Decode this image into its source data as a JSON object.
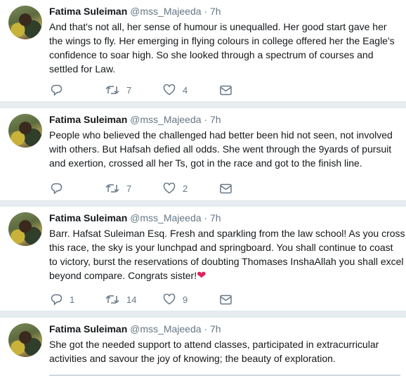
{
  "tweets": [
    {
      "name": "Fatima Suleiman",
      "handle": "@mss_Majeeda",
      "dot": "·",
      "time": "7h",
      "lines": [
        "And that's not all, her sense of humour is unequalled. Her good start gave her",
        "the wings to fly. Her emerging in flying colours in college offered her the Eagle's",
        "confidence to soar high. So she looked through a spectrum of courses and",
        "settled for Law."
      ],
      "reply_count": "",
      "retweet_count": "7",
      "like_count": "4"
    },
    {
      "name": "Fatima Suleiman",
      "handle": "@mss_Majeeda",
      "dot": "·",
      "time": "7h",
      "lines": [
        "People who believed the challenged had better been hid not seen, not involved",
        "with others. But Hafsah defied all odds. She went through the 9yards of pursuit",
        "and exertion, crossed all her Ts, got in the race and got to the finish line."
      ],
      "reply_count": "",
      "retweet_count": "7",
      "like_count": "2"
    },
    {
      "name": "Fatima Suleiman",
      "handle": "@mss_Majeeda",
      "dot": "·",
      "time": "7h",
      "lines": [
        "Barr. Hafsat Suleiman Esq. Fresh and sparkling from the law school!  As you cross",
        "this race, the sky is your lunchpad and springboard. You shall continue to coast",
        "to victory, burst the reservations of doubting Thomases InshaAllah you shall excel",
        "beyond compare. Congrats sister!"
      ],
      "emoji": "❤",
      "reply_count": "1",
      "retweet_count": "14",
      "like_count": "9"
    },
    {
      "name": "Fatima Suleiman",
      "handle": "@mss_Majeeda",
      "dot": "·",
      "time": "7h",
      "lines": [
        "She got the needed support to attend classes, participated in extracurricular",
        "activities and savour the joy of knowing; the beauty of exploration."
      ]
    }
  ],
  "icons": {
    "reply": "reply-icon",
    "retweet": "retweet-icon",
    "like": "heart-icon",
    "dm": "envelope-icon"
  },
  "colors": {
    "text": "#14171a",
    "muted": "#657786",
    "separator": "#e6ecf0",
    "heart": "#e0245e"
  }
}
